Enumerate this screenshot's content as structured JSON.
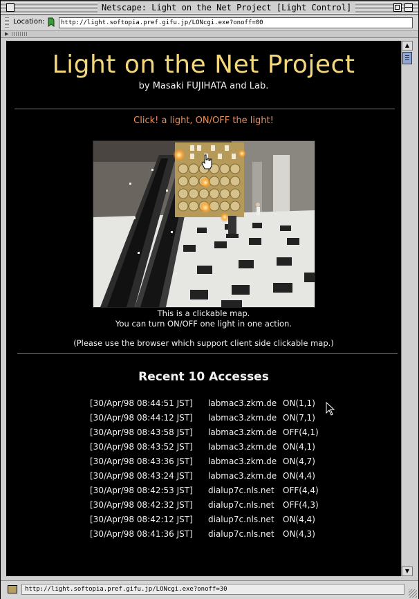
{
  "window": {
    "title": "Netscape: Light on the Net Project [Light Control]"
  },
  "location_bar": {
    "label": "Location:",
    "url": "http://light.softopia.pref.gifu.jp/LONcgi.exe?onoff=00"
  },
  "page": {
    "title": "Light on the Net Project",
    "byline": "by Masaki FUJIHATA and Lab.",
    "instruction": "Click! a light, ON/OFF the light!",
    "note_line1": "This is a clickable map.",
    "note_line2": "You can turn ON/OFF one light in one action.",
    "note_line3": "(Please use the browser which support client side clickable map.)",
    "recent_title": "Recent 10 Accesses",
    "accesses": [
      {
        "time": "[30/Apr/98 08:44:51 JST]",
        "host": "labmac3.zkm.de",
        "action": "ON(1,1)"
      },
      {
        "time": "[30/Apr/98 08:44:12 JST]",
        "host": "labmac3.zkm.de",
        "action": "ON(7,1)"
      },
      {
        "time": "[30/Apr/98 08:43:58 JST]",
        "host": "labmac3.zkm.de",
        "action": "OFF(4,1)"
      },
      {
        "time": "[30/Apr/98 08:43:52 JST]",
        "host": "labmac3.zkm.de",
        "action": "ON(4,1)"
      },
      {
        "time": "[30/Apr/98 08:43:36 JST]",
        "host": "labmac3.zkm.de",
        "action": "ON(4,7)"
      },
      {
        "time": "[30/Apr/98 08:43:24 JST]",
        "host": "labmac3.zkm.de",
        "action": "ON(4,4)"
      },
      {
        "time": "[30/Apr/98 08:42:53 JST]",
        "host": "dialup7c.nls.net",
        "action": "OFF(4,4)"
      },
      {
        "time": "[30/Apr/98 08:42:32 JST]",
        "host": "dialup7c.nls.net",
        "action": "OFF(4,3)"
      },
      {
        "time": "[30/Apr/98 08:42:12 JST]",
        "host": "dialup7c.nls.net",
        "action": "ON(4,4)"
      },
      {
        "time": "[30/Apr/98 08:41:36 JST]",
        "host": "dialup7c.nls.net",
        "action": "ON(4,3)"
      }
    ]
  },
  "status_bar": {
    "text": "http://light.softopia.pref.gifu.jp/LONcgi.exe?onoff=30"
  },
  "colors": {
    "page_background": "#000000",
    "title_color": "#f4d77a",
    "instruction_color": "#ec8d5c",
    "text_color": "#f2f2f2"
  },
  "icons": {
    "location": "location-bookmark-icon",
    "security": "unlocked-security-icon",
    "cursor": "arrow-cursor-icon",
    "hand": "pointing-hand-icon"
  }
}
